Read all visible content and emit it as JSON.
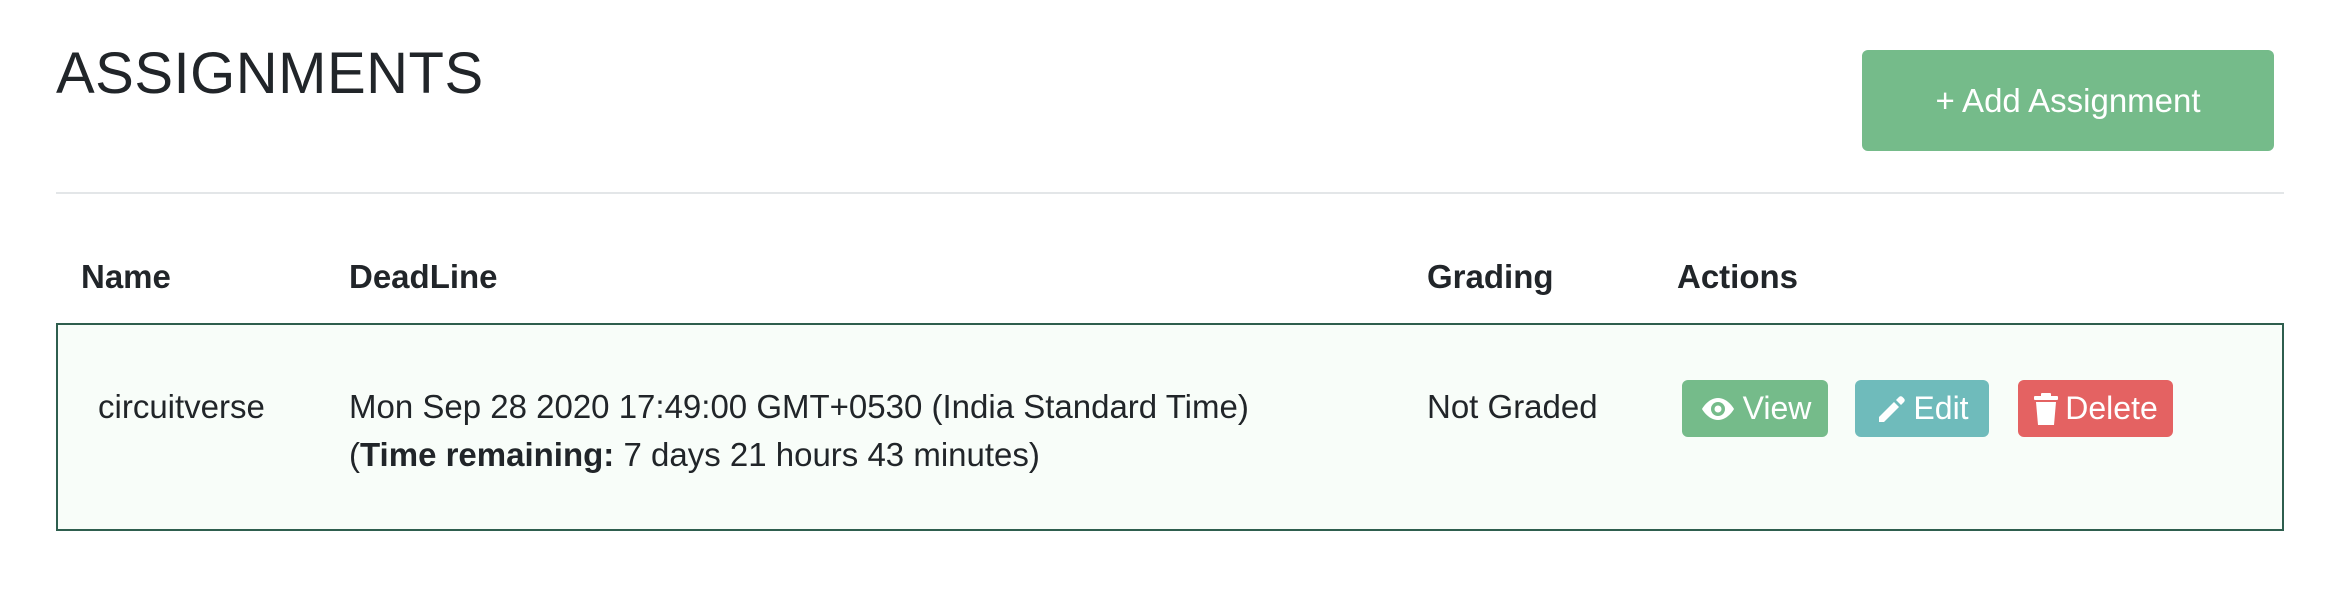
{
  "header": {
    "title": "ASSIGNMENTS",
    "add_button_label": "+ Add Assignment"
  },
  "table": {
    "columns": [
      "Name",
      "DeadLine",
      "Grading",
      "Actions"
    ],
    "rows": [
      {
        "name": "circuitverse",
        "deadline": "Mon Sep 28 2020 17:49:00 GMT+0530 (India Standard Time)",
        "remaining_prefix": "(",
        "remaining_label": "Time remaining:",
        "remaining_value": " 7 days 21 hours 43 minutes)",
        "grading": "Not Graded",
        "actions": {
          "view_label": "View",
          "edit_label": "Edit",
          "delete_label": "Delete"
        }
      }
    ]
  },
  "colors": {
    "primary_green": "#75bb8a",
    "info_teal": "#6fbbbb",
    "danger_red": "#e46262",
    "row_border": "#2e5e4e",
    "row_background": "#f8fdf9"
  },
  "icons": {
    "view": "eye-icon",
    "edit": "pencil-icon",
    "delete": "trash-icon"
  }
}
